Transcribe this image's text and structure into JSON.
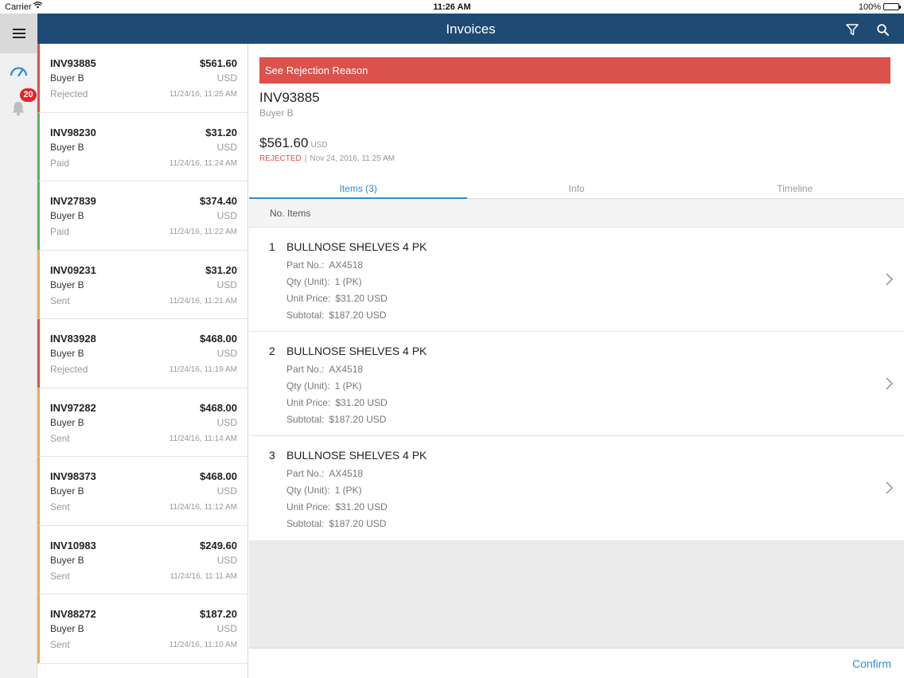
{
  "status_bar": {
    "carrier": "Carrier",
    "time": "11:26 AM",
    "battery": "100%"
  },
  "rail": {
    "notification_count": "20",
    "icons": [
      "menu-icon",
      "dashboard-icon",
      "bell-icon"
    ]
  },
  "nav": {
    "title": "Invoices",
    "icons": [
      "filter-icon",
      "search-icon"
    ],
    "color": "#1e4a73"
  },
  "invoices": [
    {
      "number": "INV93885",
      "amount": "$561.60",
      "buyer": "Buyer B",
      "currency": "USD",
      "status": "Rejected",
      "date": "11/24/16, 11:25 AM"
    },
    {
      "number": "INV98230",
      "amount": "$31.20",
      "buyer": "Buyer B",
      "currency": "USD",
      "status": "Paid",
      "date": "11/24/16, 11:24 AM"
    },
    {
      "number": "INV27839",
      "amount": "$374.40",
      "buyer": "Buyer B",
      "currency": "USD",
      "status": "Paid",
      "date": "11/24/16, 11:22 AM"
    },
    {
      "number": "INV09231",
      "amount": "$31.20",
      "buyer": "Buyer B",
      "currency": "USD",
      "status": "Sent",
      "date": "11/24/16, 11:21 AM"
    },
    {
      "number": "INV83928",
      "amount": "$468.00",
      "buyer": "Buyer B",
      "currency": "USD",
      "status": "Rejected",
      "date": "11/24/16, 11:19 AM"
    },
    {
      "number": "INV97282",
      "amount": "$468.00",
      "buyer": "Buyer B",
      "currency": "USD",
      "status": "Sent",
      "date": "11/24/16, 11:14 AM"
    },
    {
      "number": "INV98373",
      "amount": "$468.00",
      "buyer": "Buyer B",
      "currency": "USD",
      "status": "Sent",
      "date": "11/24/16, 11:12 AM"
    },
    {
      "number": "INV10983",
      "amount": "$249.60",
      "buyer": "Buyer B",
      "currency": "USD",
      "status": "Sent",
      "date": "11/24/16, 11:11 AM"
    },
    {
      "number": "INV88272",
      "amount": "$187.20",
      "buyer": "Buyer B",
      "currency": "USD",
      "status": "Sent",
      "date": "11/24/16, 11:10 AM"
    }
  ],
  "status_colors": {
    "Rejected": "#d9534f",
    "Paid": "#5cb85c",
    "Sent": "#f0ad4e"
  },
  "detail": {
    "banner": "See Rejection Reason",
    "number": "INV93885",
    "buyer": "Buyer B",
    "amount": "$561.60",
    "currency": "USD",
    "status": "REJECTED",
    "separator": "|",
    "date": "Nov 24, 2016, 11:25 AM",
    "tabs": [
      {
        "label": "Items (3)",
        "active": true
      },
      {
        "label": "Info",
        "active": false
      },
      {
        "label": "Timeline",
        "active": false
      }
    ],
    "column_header": "No. Items",
    "items": [
      {
        "index": "1",
        "name": "BULLNOSE SHELVES 4 PK",
        "part_label": "Part No.:",
        "part": "AX4518",
        "qty_label": "Qty (Unit):",
        "qty": "1 (PK)",
        "price_label": "Unit Price:",
        "price": "$31.20 USD",
        "subtotal_label": "Subtotal:",
        "subtotal": "$187.20 USD"
      },
      {
        "index": "2",
        "name": "BULLNOSE SHELVES 4 PK",
        "part_label": "Part No.:",
        "part": "AX4518",
        "qty_label": "Qty (Unit):",
        "qty": "1 (PK)",
        "price_label": "Unit Price:",
        "price": "$31.20 USD",
        "subtotal_label": "Subtotal:",
        "subtotal": "$187.20 USD"
      },
      {
        "index": "3",
        "name": "BULLNOSE SHELVES 4 PK",
        "part_label": "Part No.:",
        "part": "AX4518",
        "qty_label": "Qty (Unit):",
        "qty": "1 (PK)",
        "price_label": "Unit Price:",
        "price": "$31.20 USD",
        "subtotal_label": "Subtotal:",
        "subtotal": "$187.20 USD"
      }
    ],
    "confirm_label": "Confirm",
    "accent": "#2d8ccf",
    "banner_color": "#db524d"
  }
}
